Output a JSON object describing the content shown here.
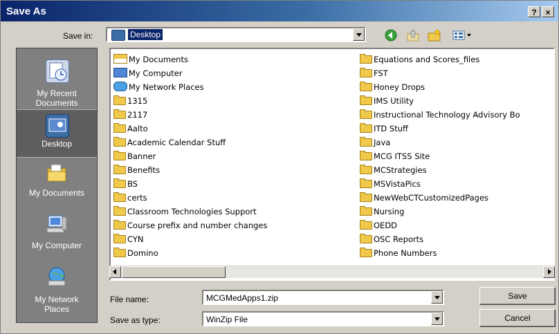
{
  "window": {
    "title": "Save As",
    "help_label": "?",
    "close_label": "×"
  },
  "toolbar": {
    "save_in_label": "Save in:",
    "save_in_value": "Desktop",
    "icons": [
      "back-icon",
      "up-folder-icon",
      "new-folder-icon",
      "views-menu-icon"
    ]
  },
  "places": [
    {
      "label_line1": "My Recent",
      "label_line2": "Documents",
      "icon": "recent-documents-icon"
    },
    {
      "label_line1": "Desktop",
      "label_line2": "",
      "icon": "desktop-icon"
    },
    {
      "label_line1": "My Documents",
      "label_line2": "",
      "icon": "my-documents-icon"
    },
    {
      "label_line1": "My Computer",
      "label_line2": "",
      "icon": "my-computer-icon"
    },
    {
      "label_line1": "My Network",
      "label_line2": "Places",
      "icon": "network-places-icon"
    }
  ],
  "files": {
    "column1": [
      "My Documents",
      "My Computer",
      "My Network Places",
      "1315",
      "2117",
      "Aalto",
      "Academic Calendar Stuff",
      "Banner",
      "Benefits",
      "BS",
      "certs",
      "Classroom Technologies Support",
      "Course prefix and number changes",
      "CYN",
      "Domino"
    ],
    "column2": [
      "Equations and Scores_files",
      "FST",
      "Honey Drops",
      "IMS Utility",
      "Instructional Technology Advisory Bo",
      "ITD Stuff",
      "Java",
      "MCG ITSS Site",
      "MCStrategies",
      "MSVistaPics",
      "NewWebCTCustomizedPages",
      "Nursing",
      "OEDD",
      "OSC Reports",
      "Phone Numbers"
    ]
  },
  "form": {
    "file_name_label": "File name:",
    "file_name_value": "MCGMedApps1.zip",
    "save_type_label": "Save as type:",
    "save_type_value": "WinZip File"
  },
  "buttons": {
    "save": "Save",
    "cancel": "Cancel"
  },
  "colors": {
    "title_bar": "#0a246a",
    "selection": "#0a246a",
    "folder": "#f0c84a",
    "places_bar": "#808080"
  }
}
